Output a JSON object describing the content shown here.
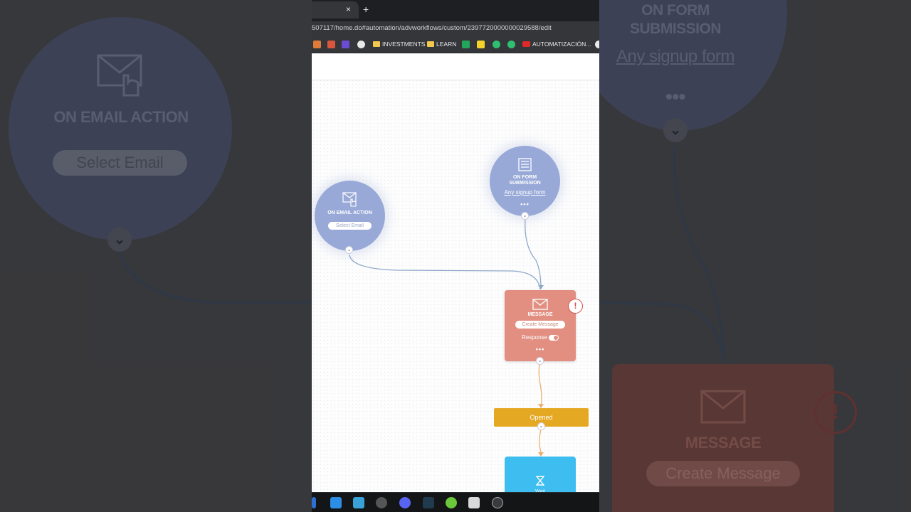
{
  "browser": {
    "tab_close": "×",
    "tab_new": "+",
    "url": "507117/home.do#automation/advworkflows/custom/2397720000000029588/edit",
    "bookmarks": [
      "INVESTMENTS",
      "LEARN",
      "AUTOMATIZACIÓN..."
    ]
  },
  "workflow": {
    "email_trigger": {
      "title": "ON EMAIL ACTION",
      "button": "Select Email",
      "icon": "mail-pointer-icon"
    },
    "form_trigger": {
      "title_line1": "ON FORM",
      "title_line2": "SUBMISSION",
      "link": "Any signup form",
      "more": "•••",
      "icon": "form-icon"
    },
    "message": {
      "title": "MESSAGE",
      "button": "Create Message",
      "response_label": "Response",
      "more": "•••",
      "alert": "!",
      "icon": "envelope-icon"
    },
    "opened": {
      "label": "Opened"
    },
    "wait": {
      "label": "Wait",
      "icon": "hourglass-icon"
    },
    "chevron": "⌄"
  },
  "colors": {
    "trigger": "#98a9d8",
    "message": "#e28f81",
    "opened": "#e5a823",
    "wait": "#3ebdf0",
    "edge_trigger": "#8fa8c8",
    "edge_branch": "#e8b070"
  }
}
